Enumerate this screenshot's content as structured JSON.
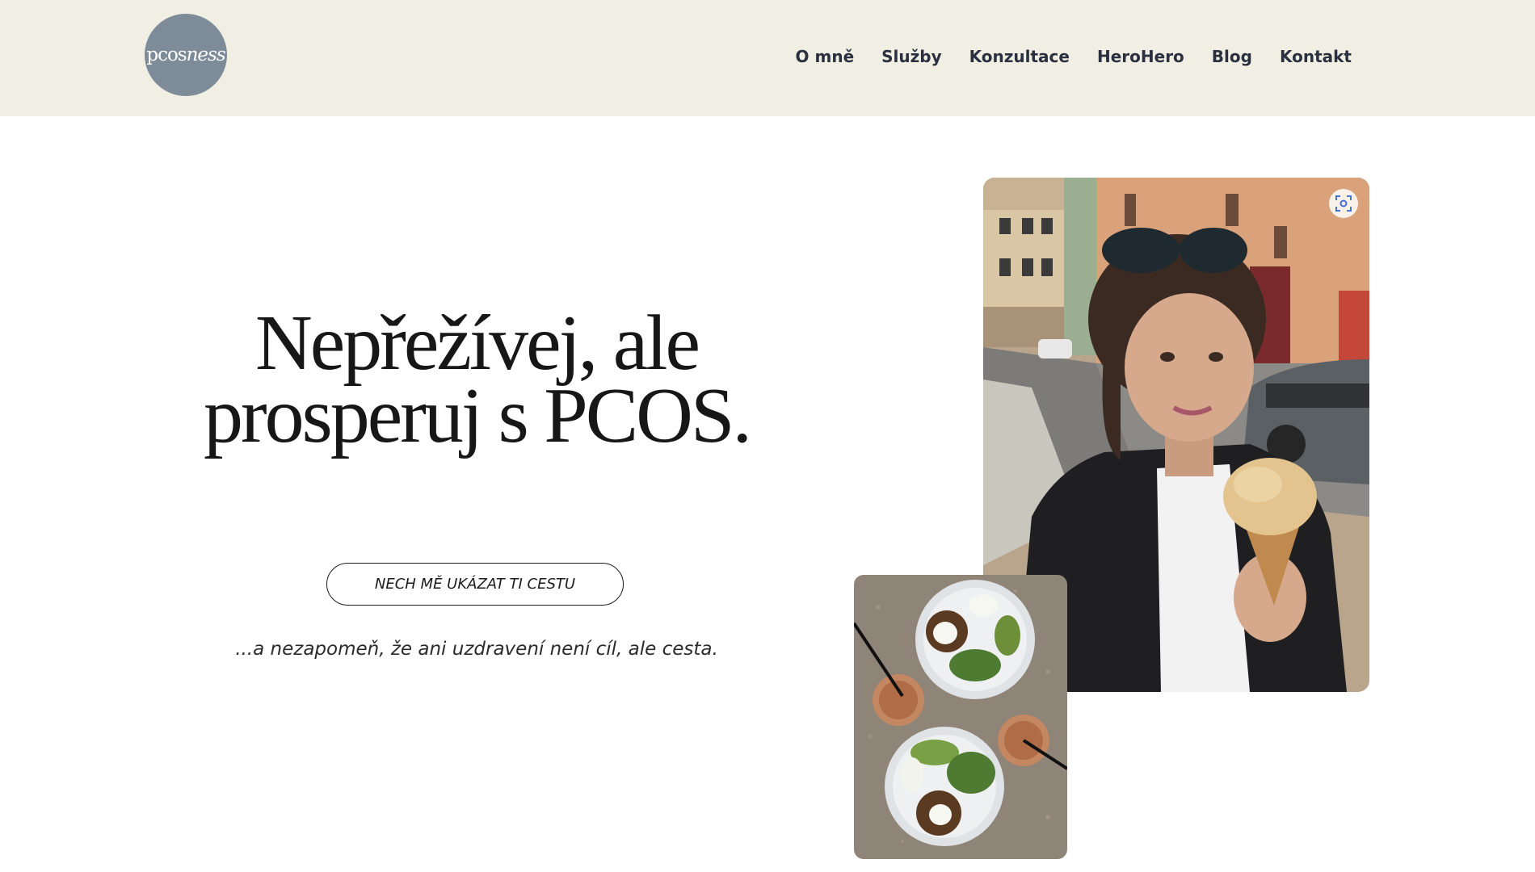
{
  "brand": {
    "logo_part1": "pcos",
    "logo_part2": "ness"
  },
  "nav": {
    "items": [
      {
        "label": "O mně"
      },
      {
        "label": "Služby"
      },
      {
        "label": "Konzultace"
      },
      {
        "label": "HeroHero"
      },
      {
        "label": "Blog"
      },
      {
        "label": "Kontakt"
      }
    ]
  },
  "hero": {
    "title_line1": "Nepřežívej, ale",
    "title_line2": "prosperuj s PCOS.",
    "cta_label": "NECH MĚ UKÁZAT TI CESTU",
    "tagline": "...a nezapomeň, že ani uzdravení není cíl, ale cesta."
  },
  "images": {
    "main_photo": "woman-with-ice-cream-photo",
    "food_photo": "brunch-plates-photo"
  },
  "colors": {
    "header_bg": "#f1efe3",
    "logo_bg": "#7e8c99",
    "nav_text": "#2a3040",
    "title_text": "#171717"
  }
}
